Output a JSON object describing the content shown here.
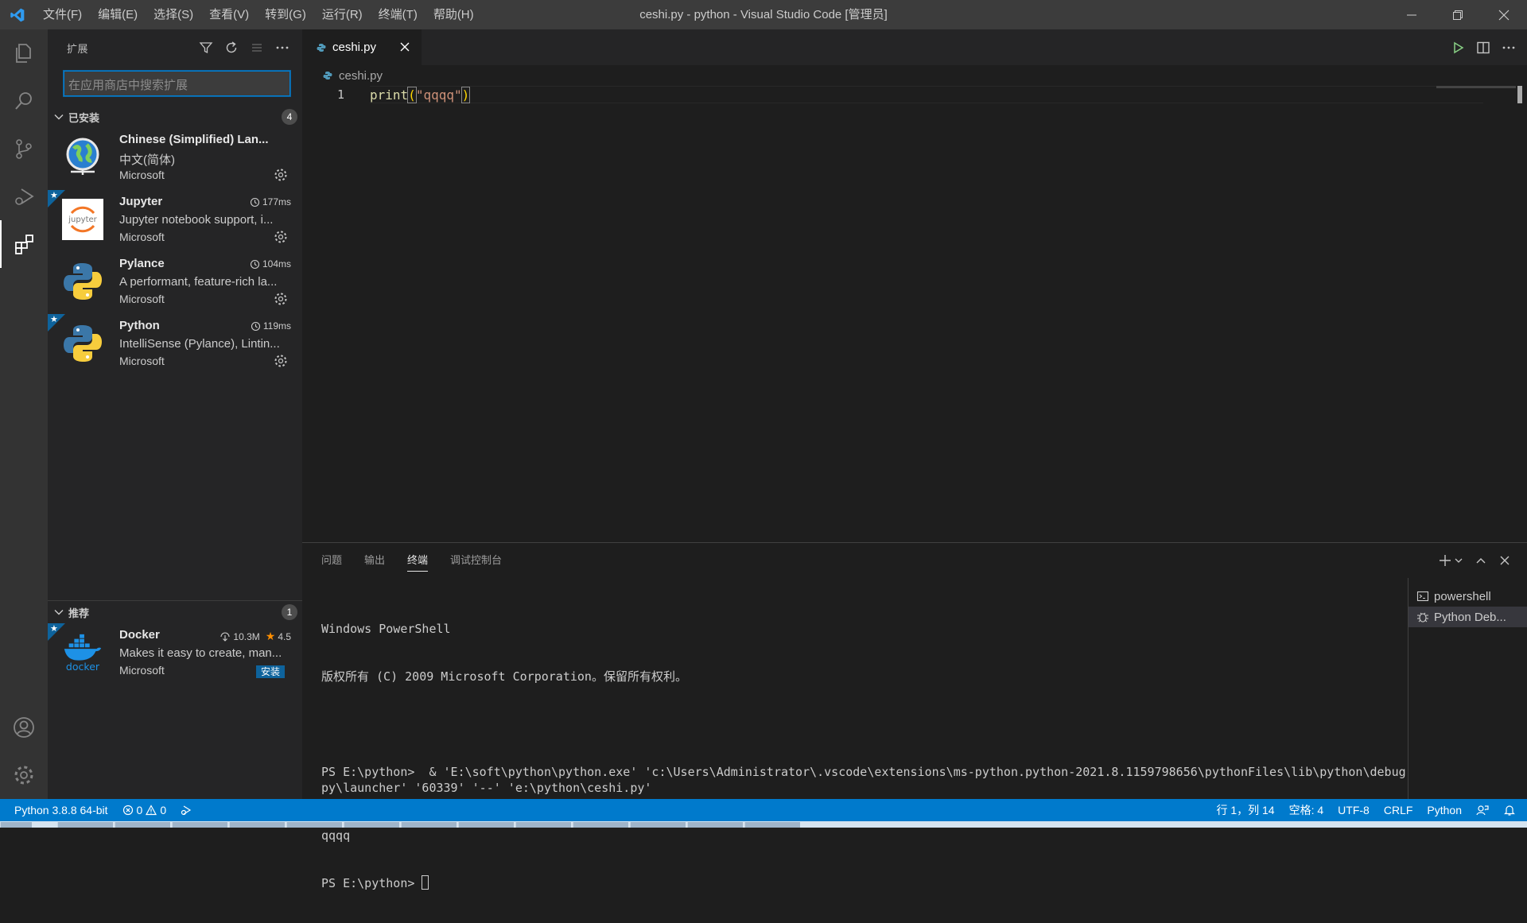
{
  "titlebar": {
    "title": "ceshi.py - python - Visual Studio Code [管理员]",
    "menu": [
      "文件(F)",
      "编辑(E)",
      "选择(S)",
      "查看(V)",
      "转到(G)",
      "运行(R)",
      "终端(T)",
      "帮助(H)"
    ]
  },
  "colors": {
    "accent": "#007acc",
    "titlebar": "#3c3c3c",
    "sidebar": "#252526",
    "editor": "#1e1e1e"
  },
  "activity": [
    "explorer-icon",
    "search-icon",
    "source-control-icon",
    "run-debug-icon",
    "extensions-icon",
    "accounts-icon",
    "manage-gear-icon"
  ],
  "sidebar": {
    "title": "扩展",
    "search_placeholder": "在应用商店中搜索扩展",
    "installed": {
      "label": "已安装",
      "count": "4",
      "items": [
        {
          "name": "Chinese (Simplified) Lan...",
          "desc": "中文(简体)",
          "publisher": "Microsoft",
          "meta": ""
        },
        {
          "name": "Jupyter",
          "desc": "Jupyter notebook support, i...",
          "publisher": "Microsoft",
          "meta": "177ms"
        },
        {
          "name": "Pylance",
          "desc": "A performant, feature-rich la...",
          "publisher": "Microsoft",
          "meta": "104ms"
        },
        {
          "name": "Python",
          "desc": "IntelliSense (Pylance), Lintin...",
          "publisher": "Microsoft",
          "meta": "119ms"
        }
      ]
    },
    "recommended": {
      "label": "推荐",
      "count": "1",
      "items": [
        {
          "name": "Docker",
          "desc": "Makes it easy to create, man...",
          "publisher": "Microsoft",
          "downloads": "10.3M",
          "rating": "4.5",
          "install_label": "安装"
        }
      ]
    }
  },
  "editor": {
    "tab_label": "ceshi.py",
    "breadcrumb": "ceshi.py",
    "line_number": "1",
    "code": {
      "fn": "print",
      "open": "(",
      "str": "\"qqqq\"",
      "close": ")"
    }
  },
  "panel": {
    "tabs": [
      "问题",
      "输出",
      "终端",
      "调试控制台"
    ],
    "terminal_lines": [
      "Windows PowerShell",
      "版权所有 (C) 2009 Microsoft Corporation。保留所有权利。",
      "",
      "PS E:\\python>  & 'E:\\soft\\python\\python.exe' 'c:\\Users\\Administrator\\.vscode\\extensions\\ms-python.python-2021.8.1159798656\\pythonFiles\\lib\\python\\debugpy\\launcher' '60339' '--' 'e:\\python\\ceshi.py'",
      "qqqq"
    ],
    "prompt": "PS E:\\python> ",
    "terminals": [
      "powershell",
      "Python Deb..."
    ]
  },
  "statusbar": {
    "python": "Python 3.8.8 64-bit",
    "errors": "0",
    "warnings": "0",
    "position": "行 1，列 14",
    "spaces": "空格: 4",
    "encoding": "UTF-8",
    "eol": "CRLF",
    "language": "Python"
  }
}
